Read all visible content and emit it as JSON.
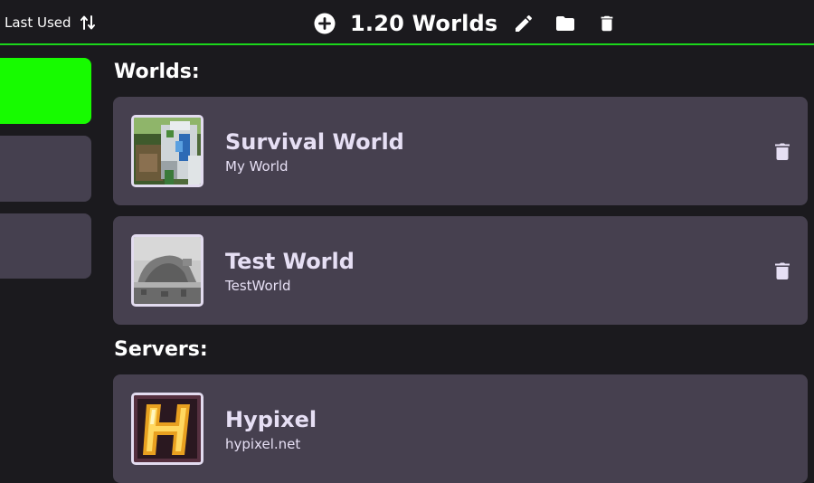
{
  "colors": {
    "background": "#1b1a1e",
    "accent": "#17fb00",
    "card": "#46404f",
    "text_light": "#e6dff4"
  },
  "toolbar": {
    "sort_label": "Last Used",
    "sort_icon": "sort-arrows-icon",
    "add_icon": "plus-circle-icon",
    "title": "1.20 Worlds",
    "edit_icon": "pencil-icon",
    "folder_icon": "folder-icon",
    "delete_icon": "trash-icon"
  },
  "sidebar": {
    "items": [
      {
        "label": "",
        "active": true
      },
      {
        "label": "",
        "active": false
      },
      {
        "label": "",
        "active": false
      }
    ]
  },
  "worlds": {
    "heading": "Worlds:",
    "items": [
      {
        "title": "Survival World",
        "subtitle": "My World",
        "thumbnail": "survival-world-thumbnail"
      },
      {
        "title": "Test World",
        "subtitle": "TestWorld",
        "thumbnail": "test-world-thumbnail"
      }
    ]
  },
  "servers": {
    "heading": "Servers:",
    "items": [
      {
        "title": "Hypixel",
        "subtitle": "hypixel.net",
        "thumbnail": "hypixel-logo"
      }
    ]
  }
}
